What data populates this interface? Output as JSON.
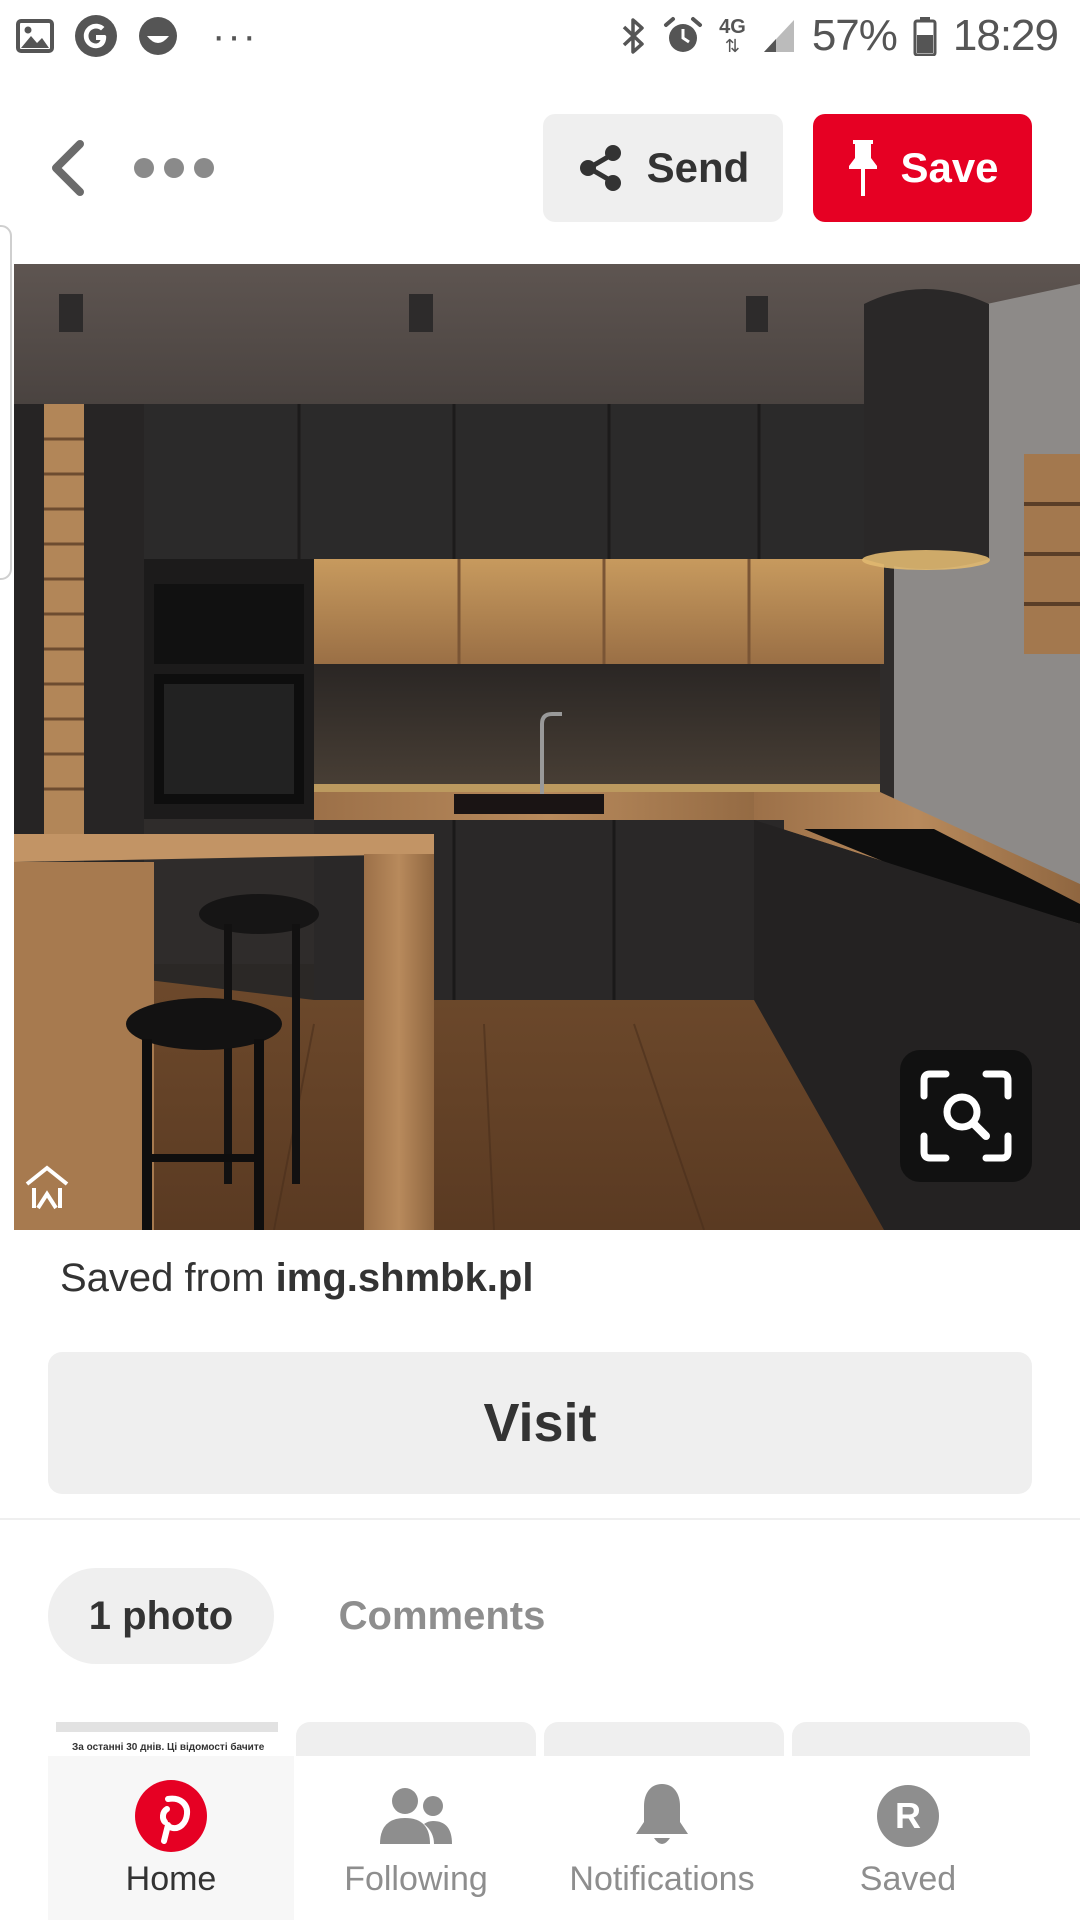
{
  "status_bar": {
    "more": "···",
    "battery": "57%",
    "time": "18:29",
    "network": "4G"
  },
  "toolbar": {
    "send_label": "Send",
    "save_label": "Save"
  },
  "pin": {
    "saved_from_prefix": "Saved from ",
    "saved_from_domain": "img.shmbk.pl",
    "visit_label": "Visit"
  },
  "tabs": {
    "photos_label": "1 photo",
    "comments_label": "Comments"
  },
  "photo_strip": {
    "first_caption": "За останні 30 днів. Ці відомості бачите"
  },
  "bottom_nav": {
    "items": [
      {
        "label": "Home",
        "icon": "pinterest-logo-icon",
        "active": true
      },
      {
        "label": "Following",
        "icon": "people-icon"
      },
      {
        "label": "Notifications",
        "icon": "bell-icon"
      },
      {
        "label": "Saved",
        "icon": "avatar-icon"
      }
    ],
    "avatar_letter": "R"
  },
  "colors": {
    "brand_red": "#e60023",
    "button_gray": "#efefef",
    "text_dark": "#333333",
    "text_muted": "#8e8e8e"
  }
}
